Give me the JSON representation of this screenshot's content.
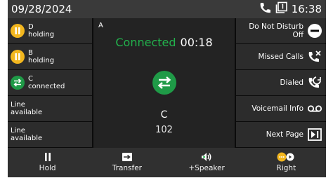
{
  "status": {
    "date": "09/28/2024",
    "time": "16:38"
  },
  "lines": [
    {
      "name": "D",
      "state": "holding"
    },
    {
      "name": "B",
      "state": "holding"
    },
    {
      "name": "C",
      "state": "connected"
    },
    {
      "name": "Line",
      "state": "available"
    },
    {
      "name": "Line",
      "state": "available"
    }
  ],
  "call": {
    "line": "A",
    "status": "Connected",
    "duration": "00:18",
    "name": "C",
    "number": "102"
  },
  "features": [
    {
      "line1": "Do Not Disturb",
      "line2": "Off",
      "icon": "dnd-icon"
    },
    {
      "line1": "Missed Calls",
      "line2": "",
      "icon": "missed-call-icon"
    },
    {
      "line1": "Dialed",
      "line2": "",
      "icon": "dialed-call-icon"
    },
    {
      "line1": "Voicemail Info",
      "line2": "",
      "icon": "voicemail-icon"
    },
    {
      "line1": "Next Page",
      "line2": "",
      "icon": "next-page-icon"
    }
  ],
  "softkeys": [
    {
      "label": "Hold",
      "icon": "pause-icon"
    },
    {
      "label": "Transfer",
      "icon": "transfer-icon"
    },
    {
      "label": "+Speaker",
      "icon": "speaker-icon"
    },
    {
      "label": "Right",
      "icon": "more-options-icon"
    }
  ],
  "colors": {
    "connected": "#22b24c",
    "hold": "#f2b61e",
    "background": "#0b0b0b"
  }
}
